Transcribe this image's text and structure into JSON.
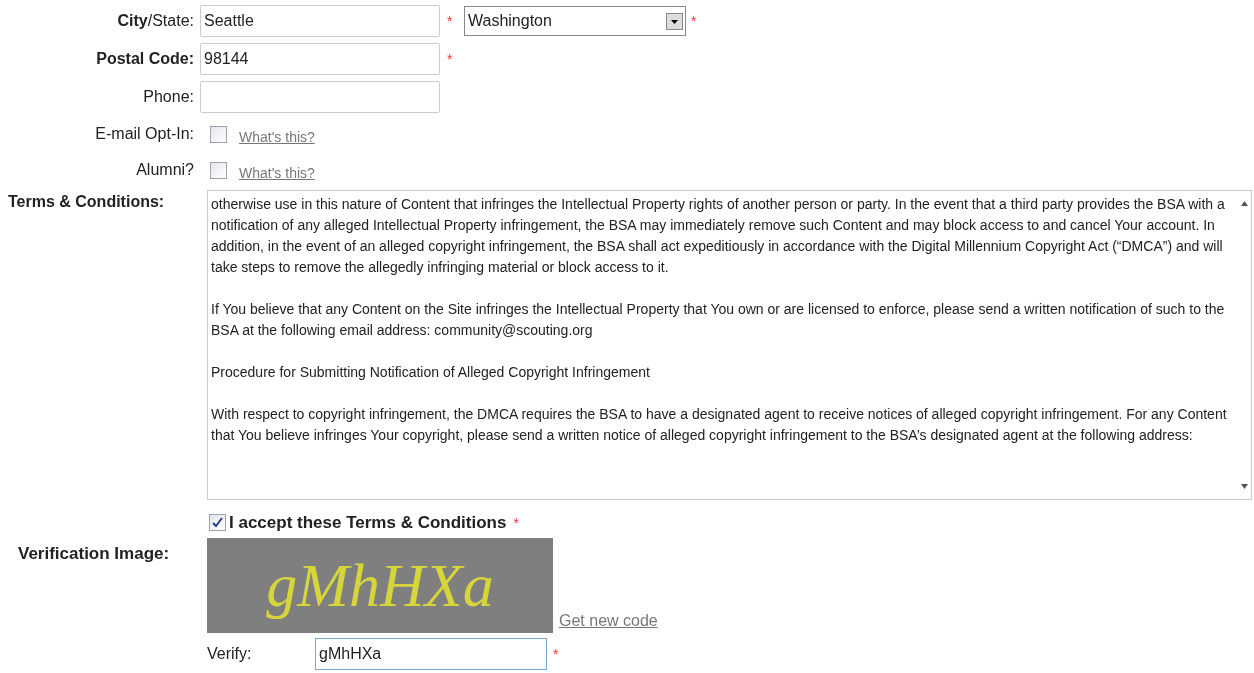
{
  "fields": [
    {
      "kind": "city",
      "label": "**City**/State:",
      "value": "Seattle",
      "asterisk": "*",
      "select": {
        "value": "Washington",
        "asterisk": "*"
      }
    },
    {
      "kind": "text",
      "label": "Postal Code:",
      "bold": true,
      "value": "98144",
      "asterisk": "*"
    },
    {
      "kind": "text",
      "label": "Phone:",
      "bold": false
    },
    {
      "kind": "checkbox",
      "label": "E-mail Opt-In:",
      "checked": false,
      "link": "What's this?"
    },
    {
      "kind": "checkbox",
      "label": "Alumni?",
      "checked": false,
      "link": "What's this?"
    }
  ],
  "terms": {
    "label": "Terms & Conditions:",
    "paragraphs": [
      "otherwise use in this nature of Content that infringes the Intellectual Property rights of another person or party.  In the event that a third party provides the BSA with a notification of any alleged Intellectual Property infringement, the BSA may immediately remove such Content and may block access to and cancel Your account.  In addition, in the event of an alleged copyright infringement, the BSA shall act expeditiously in accordance with the Digital Millennium Copyright Act (“DMCA”) and will take steps to remove the allegedly infringing material or block access to it.",
      "If You believe that any Content on the Site infringes the Intellectual Property that You own or are licensed to enforce, please send a written notification of such to the BSA at the following email address: community@scouting.org",
      "Procedure for Submitting Notification of Alleged Copyright Infringement",
      "With respect to copyright infringement, the DMCA requires the BSA to have a designated agent to receive notices of alleged copyright infringement.  For any Content that You believe infringes Your copyright, please send a written notice of alleged copyright infringement to the BSA’s designated agent at the following address:"
    ],
    "accept": {
      "label": "I accept these Terms & Conditions",
      "checked": true,
      "asterisk": "*"
    }
  },
  "verification": {
    "label": "Verification Image:",
    "code": "gMhHXa",
    "new_code_link": "Get new code",
    "verify_label": "Verify:",
    "verify_value": "gMhHXa",
    "asterisk": "*"
  }
}
